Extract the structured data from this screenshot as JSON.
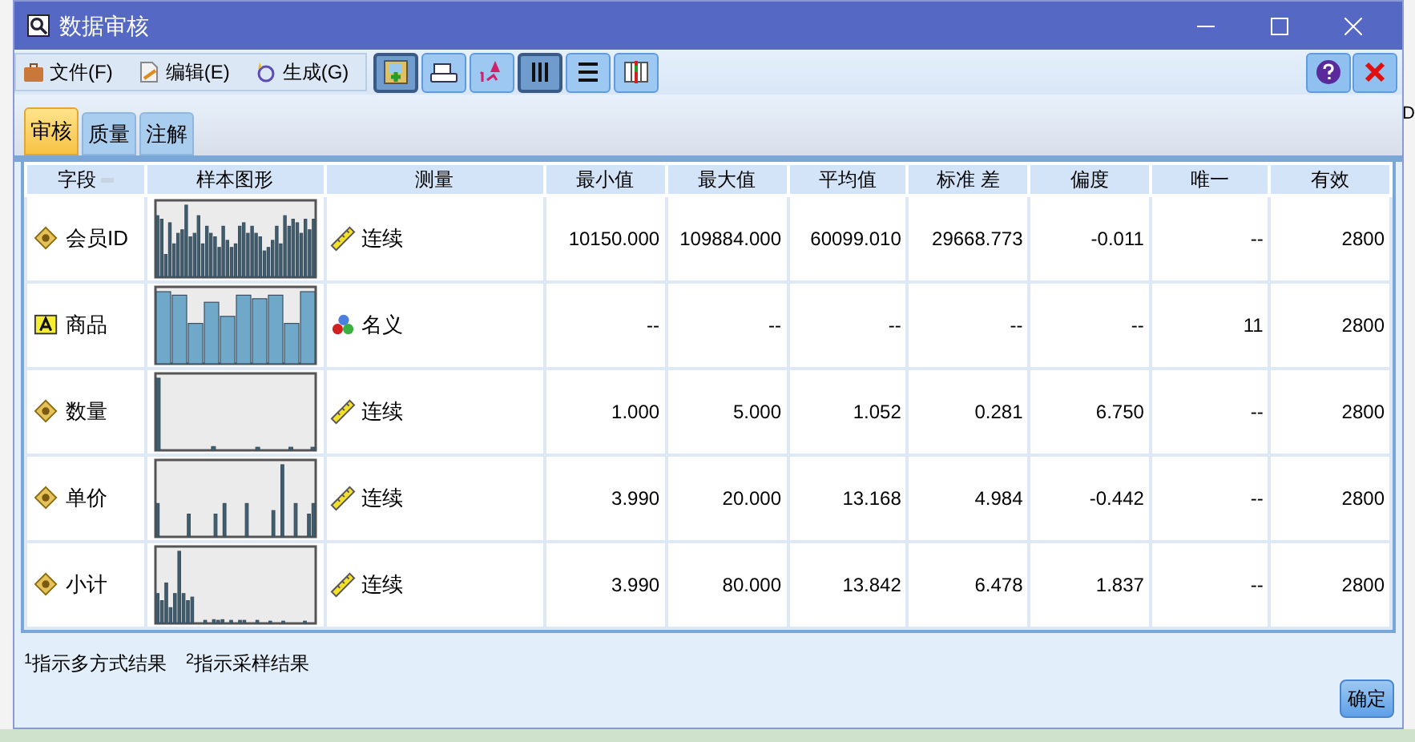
{
  "window": {
    "title": "数据审核"
  },
  "background_text": "D",
  "menu": [
    {
      "label": "文件(F)",
      "kind": "file"
    },
    {
      "label": "编辑(E)",
      "kind": "edit"
    },
    {
      "label": "生成(G)",
      "kind": "generate"
    }
  ],
  "toolbar": [
    {
      "kind": "node",
      "selected": true
    },
    {
      "kind": "print",
      "selected": false
    },
    {
      "kind": "sort",
      "selected": false
    },
    {
      "kind": "columns",
      "selected": true
    },
    {
      "kind": "rows",
      "selected": false
    },
    {
      "kind": "table",
      "selected": false
    }
  ],
  "tabs": [
    {
      "label": "审核",
      "selected": true
    },
    {
      "label": "质量",
      "selected": false
    },
    {
      "label": "注解",
      "selected": false
    }
  ],
  "table": {
    "columns": [
      "字段",
      "样本图形",
      "测量",
      "最小值",
      "最大值",
      "平均值",
      "标准 差",
      "偏度",
      "唯一",
      "有效"
    ],
    "rows": [
      {
        "cells": [
          {
            "text": "会员ID",
            "kind": "numeric"
          },
          {
            "kind": "histogram"
          },
          {
            "text": "连续",
            "kind": "continuous"
          },
          "10150.000",
          "109884.000",
          "60099.010",
          "29668.773",
          "-0.011",
          "--",
          "2800"
        ]
      },
      {
        "cells": [
          {
            "text": "商品",
            "kind": "string"
          },
          {
            "kind": "histogram"
          },
          {
            "text": "名义",
            "kind": "nominal"
          },
          "--",
          "--",
          "--",
          "--",
          "--",
          "11",
          "2800"
        ]
      },
      {
        "cells": [
          {
            "text": "数量",
            "kind": "numeric"
          },
          {
            "kind": "histogram"
          },
          {
            "text": "连续",
            "kind": "continuous"
          },
          "1.000",
          "5.000",
          "1.052",
          "0.281",
          "6.750",
          "--",
          "2800"
        ]
      },
      {
        "cells": [
          {
            "text": "单价",
            "kind": "numeric"
          },
          {
            "kind": "histogram"
          },
          {
            "text": "连续",
            "kind": "continuous"
          },
          "3.990",
          "20.000",
          "13.168",
          "4.984",
          "-0.442",
          "--",
          "2800"
        ]
      },
      {
        "cells": [
          {
            "text": "小计",
            "kind": "numeric"
          },
          {
            "kind": "histogram"
          },
          {
            "text": "连续",
            "kind": "continuous"
          },
          "3.990",
          "80.000",
          "13.842",
          "6.478",
          "1.837",
          "--",
          "2800"
        ]
      }
    ]
  },
  "footnotes": [
    "$^{1}$指示多方式结果",
    "$^{2}$指示采样结果"
  ],
  "ok_button": "确定"
}
